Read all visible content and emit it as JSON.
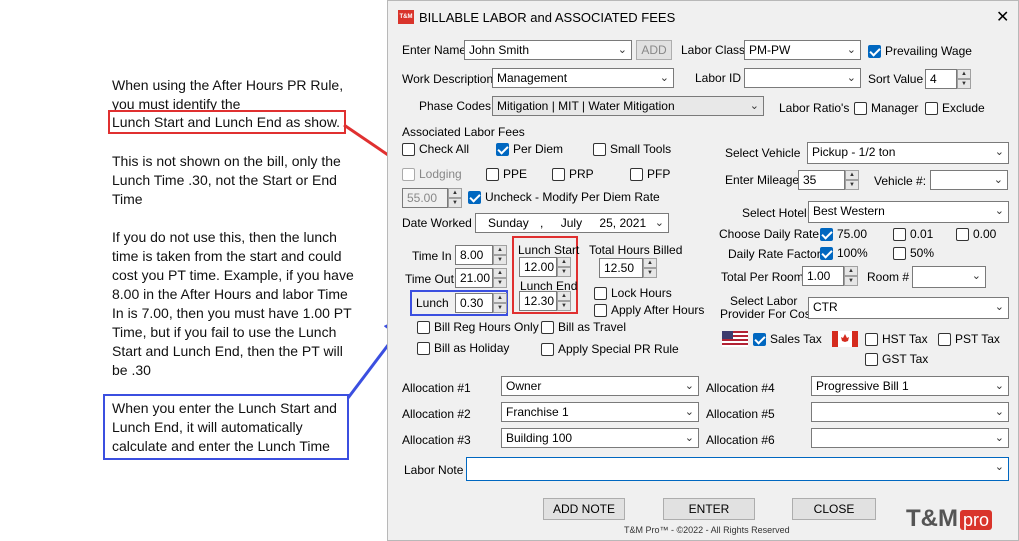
{
  "annotations": {
    "note1_line1": "When using the After Hours PR Rule,",
    "note1_line2": "you must identify the",
    "note1_highlight": "Lunch Start and Lunch End as show.",
    "note2": "This is not shown on the bill, only the Lunch Time .30, not the Start or End Time",
    "note3": "If you do not use this, then the lunch time is taken from the start and could cost you PT time. Example, if you have 8.00 in the After Hours and labor Time In is 7.00, then you must have 1.00 PT Time, but if you fail to use the Lunch Start and Lunch End, then the PT will be .30",
    "note4": "When you enter the Lunch Start and Lunch End, it will automatically calculate and enter the Lunch Time"
  },
  "dialog": {
    "logo_badge": "T&M",
    "title": "BILLABLE LABOR and ASSOCIATED FEES",
    "close_glyph": "✕"
  },
  "form": {
    "enter_name_label": "Enter Name",
    "enter_name_value": "John Smith",
    "add_label": "ADD",
    "labor_class_label": "Labor Class",
    "labor_class_value": "PM-PW",
    "prevailing_wage_label": "Prevailing Wage",
    "work_description_label": "Work Description",
    "work_description_value": "Management",
    "labor_id_label": "Labor ID",
    "labor_id_value": "",
    "sort_value_label": "Sort Value",
    "sort_value_value": "4",
    "phase_codes_label": "Phase Codes",
    "phase_codes_value": "Mitigation | MIT | Water Mitigation",
    "labor_ratios_label": "Labor Ratio's",
    "manager_label": "Manager",
    "exclude_label": "Exclude",
    "associated_fees_label": "Associated Labor Fees",
    "check_all_label": "Check All",
    "per_diem_label": "Per Diem",
    "small_tools_label": "Small Tools",
    "lodging_label": "Lodging",
    "ppe_label": "PPE",
    "prp_label": "PRP",
    "pfp_label": "PFP",
    "per_diem_amount": "55.00",
    "uncheck_label": "Uncheck - Modify Per Diem Rate",
    "date_worked_label": "Date Worked",
    "date_day": "Sunday",
    "date_sep": ",",
    "date_month": "July",
    "date_daynum_year": "25, 2021",
    "time_in_label": "Time In",
    "time_in_value": "8.00",
    "time_out_label": "Time Out",
    "time_out_value": "21.00",
    "lunch_label": "Lunch",
    "lunch_value": "0.30",
    "lunch_start_label": "Lunch Start",
    "lunch_start_value": "12.00",
    "lunch_end_label": "Lunch End",
    "lunch_end_value": "12.30",
    "total_hours_label": "Total Hours Billed",
    "total_hours_value": "12.50",
    "lock_hours_label": "Lock Hours",
    "apply_after_hours_label": "Apply After Hours",
    "bill_reg_hours_label": "Bill Reg Hours Only",
    "bill_as_travel_label": "Bill as Travel",
    "bill_as_holiday_label": "Bill as Holiday",
    "apply_special_pr_label": "Apply Special PR Rule",
    "select_vehicle_label": "Select Vehicle",
    "select_vehicle_value": "Pickup - 1/2 ton",
    "enter_mileage_label": "Enter Mileage",
    "enter_mileage_value": "35",
    "vehicle_no_label": "Vehicle #:",
    "select_hotel_label": "Select Hotel",
    "select_hotel_value": "Best Western",
    "choose_daily_rate_label": "Choose Daily Rate",
    "rate_75": "75.00",
    "rate_001": "0.01",
    "rate_000": "0.00",
    "daily_rate_factor_label": "Daily Rate Factor",
    "factor_100": "100%",
    "factor_50": "50%",
    "total_per_room_label": "Total Per Room",
    "total_per_room_value": "1.00",
    "room_no_label": "Room #",
    "labor_provider_label_1": "Select Labor",
    "labor_provider_label_2": "Provider For Cost",
    "labor_provider_value": "CTR",
    "sales_tax_label": "Sales Tax",
    "hst_tax_label": "HST Tax",
    "pst_tax_label": "PST Tax",
    "gst_tax_label": "GST Tax",
    "alloc1_label": "Allocation #1",
    "alloc1_value": "Owner",
    "alloc2_label": "Allocation #2",
    "alloc2_value": "Franchise 1",
    "alloc3_label": "Allocation #3",
    "alloc3_value": "Building 100",
    "alloc4_label": "Allocation #4",
    "alloc4_value": "Progressive Bill 1",
    "alloc5_label": "Allocation #5",
    "alloc5_value": "",
    "alloc6_label": "Allocation #6",
    "alloc6_value": "",
    "labor_note_label": "Labor Note",
    "labor_note_value": ""
  },
  "buttons": {
    "add_note": "ADD NOTE",
    "enter": "ENTER",
    "close": "CLOSE"
  },
  "footer": {
    "copyright": "T&M Pro™ - ©2022 - All Rights Reserved",
    "brand_tm": "T&M",
    "brand_pro": "pro"
  },
  "colors": {
    "accent_blue": "#0067c0",
    "red_box": "#e03030",
    "blue_box": "#3b4fe0",
    "brand_red": "#d9342b"
  }
}
